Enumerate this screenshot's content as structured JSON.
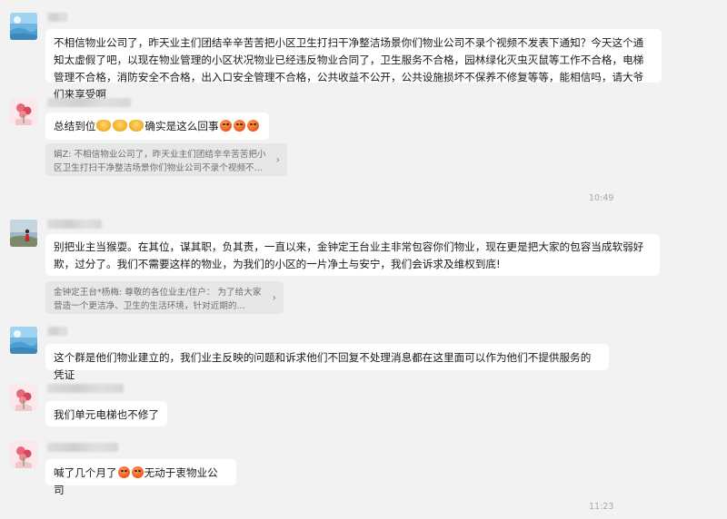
{
  "messages": [
    {
      "avatar": "landscape-avatar-icon",
      "text": "不相信物业公司了，昨天业主们团结辛辛苦苦把小区卫生打扫干净整洁场景你们物业公司不录个视频不发表下通知？今天这个通知太虚假了吧，以现在物业管理的小区状况物业已经违反物业合同了，卫生服务不合格，园林绿化灭虫灭鼠等工作不合格，电梯管理不合格，消防安全不合格，出入口安全管理不合格，公共收益不公开，公共设施损坏不保养不修复等等，能相信吗，请大爷们来享受啊"
    },
    {
      "avatar": "flower-avatar-icon",
      "text_before": "总结到位",
      "text_middle": "确实是这么回事",
      "quote": "娟Z: 不相信物业公司了，昨天业主们团结辛辛苦苦把小区卫生打扫干净整洁场景你们物业公司不录个视频不...",
      "time": "10:49"
    },
    {
      "avatar": "person-avatar-icon",
      "text": "别把业主当猴耍。在其位，谋其职，负其责，一直以来，金钟定王台业主非常包容你们物业，现在更是把大家的包容当成软弱好欺，过分了。我们不需要这样的物业，为我们的小区的一片净土与安宁，我们会诉求及维权到底!",
      "quote": "金钟定王台*杨梅: 尊敬的各位业主/住户：       为了给大家营造一个更洁净、卫生的生活环境，针对近期的..."
    },
    {
      "avatar": "landscape-avatar-icon",
      "text": "这个群是他们物业建立的，我们业主反映的问题和诉求他们不回复不处理消息都在这里面可以作为他们不提供服务的凭证"
    },
    {
      "avatar": "flower-avatar-icon",
      "text": "我们单元电梯也不修了"
    },
    {
      "avatar": "flower-avatar-icon",
      "text_before": "喊了几个月了",
      "text_after": "无动于衷物业公司",
      "time": "11:23"
    }
  ],
  "colors": {
    "background": "#f2f2f2",
    "bubble": "#ffffff",
    "quote": "#e7e7e7",
    "time": "#a8a8a8"
  }
}
